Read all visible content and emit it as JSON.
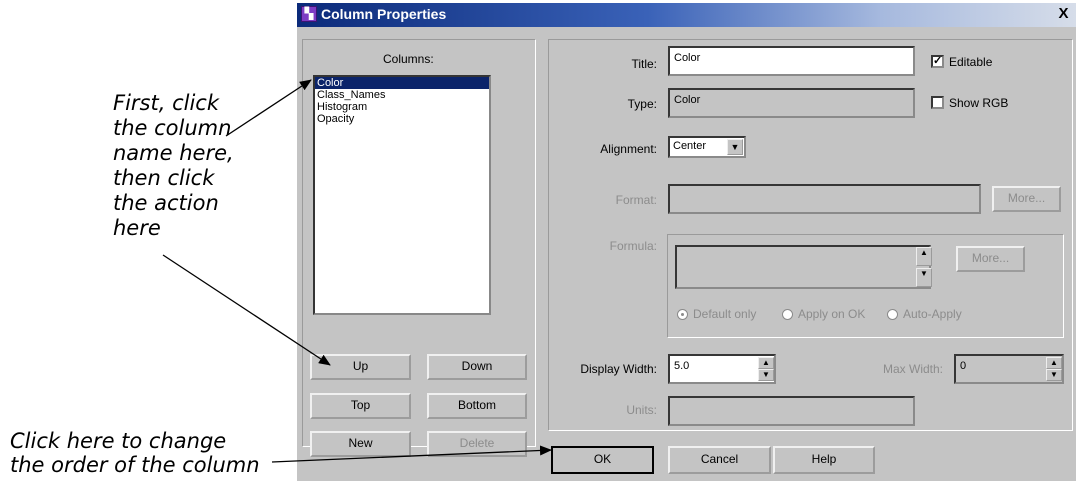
{
  "annotations": {
    "first_click_lines": [
      "First, click",
      "the column",
      "name here,",
      "then click",
      "the action",
      "here"
    ],
    "change_order_lines": [
      "Click here to change",
      "the order of the column"
    ]
  },
  "dialog": {
    "title": "Column Properties",
    "close_glyph": "X",
    "left_panel": {
      "columns_label": "Columns:",
      "columns": [
        "Color",
        "Class_Names",
        "Histogram",
        "Opacity"
      ],
      "selected_index": 0,
      "buttons": {
        "up": "Up",
        "down": "Down",
        "top": "Top",
        "bottom": "Bottom",
        "new": "New",
        "delete": "Delete"
      }
    },
    "right_panel": {
      "title_label": "Title:",
      "title_value": "Color",
      "editable_label": "Editable",
      "editable_checked": true,
      "type_label": "Type:",
      "type_value": "Color",
      "show_rgb_label": "Show RGB",
      "show_rgb_checked": false,
      "alignment_label": "Alignment:",
      "alignment_value": "Center",
      "format_label": "Format:",
      "format_more": "More...",
      "formula_label": "Formula:",
      "formula_more": "More...",
      "radio_default_only": "Default only",
      "radio_apply_on_ok": "Apply on OK",
      "radio_auto_apply": "Auto-Apply",
      "display_width_label": "Display Width:",
      "display_width_value": "5.0",
      "max_width_label": "Max Width:",
      "max_width_value": "0",
      "units_label": "Units:"
    },
    "footer": {
      "ok": "OK",
      "cancel": "Cancel",
      "help": "Help"
    }
  }
}
